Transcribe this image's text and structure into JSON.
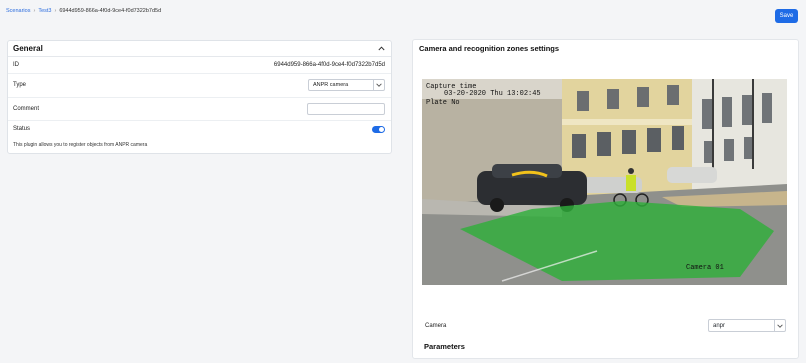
{
  "breadcrumb": {
    "items": [
      "Scenarios",
      "Test3",
      "6944d959-866a-4f0d-9ce4-f0d7322b7d5d"
    ],
    "separator": "›"
  },
  "toolbar": {
    "save_label": "Save"
  },
  "general": {
    "title": "General",
    "id_label": "ID",
    "id_value": "6944d959-866a-4f0d-9ce4-f0d7322b7d5d",
    "type_label": "Type",
    "type_value": "ANPR camera",
    "comment_label": "Comment",
    "comment_value": "",
    "status_label": "Status",
    "status_on": true,
    "note": "This plugin allows you to register objects from ANPR camera"
  },
  "camera_panel": {
    "title": "Camera and recognition zones settings",
    "overlay_capture": "Capture time",
    "overlay_date": "03-20-2020 Thu 13:02:45",
    "overlay_plate": "Plate No",
    "overlay_camera": "Camera 01",
    "camera_label": "Camera",
    "camera_value": "anpr",
    "parameters_title": "Parameters"
  },
  "colors": {
    "accent": "#1e6be6",
    "link": "#2b6cde",
    "zone": "#2fae3a"
  },
  "icons": [
    "chevron-up-icon",
    "chevron-down-icon"
  ]
}
